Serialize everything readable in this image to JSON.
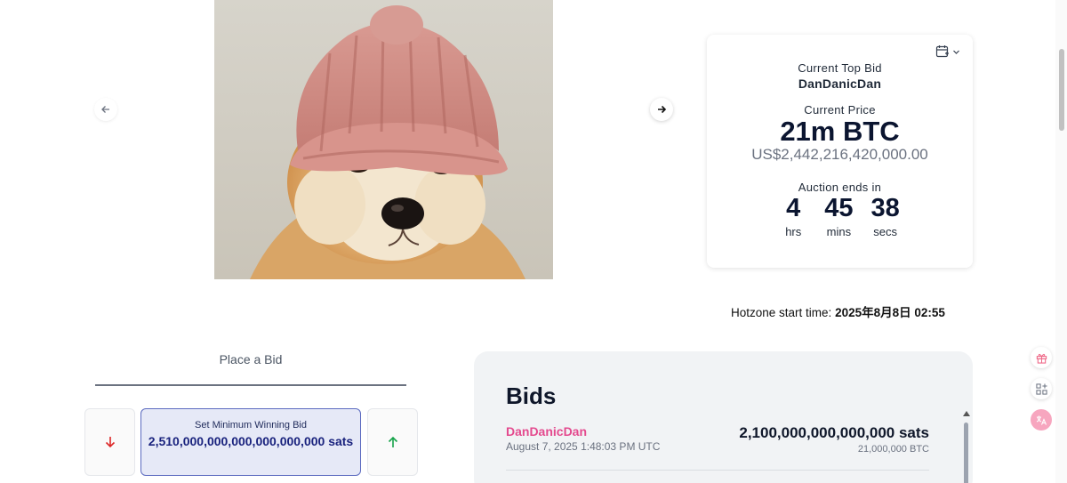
{
  "artwork": {
    "alt": "Shiba Inu dog wearing a pink knitted beanie"
  },
  "auction": {
    "top_bid_label": "Current Top Bid",
    "top_bidder": "DanDanicDan",
    "price_label": "Current Price",
    "price_btc": "21m BTC",
    "price_usd": "US$2,442,216,420,000.00",
    "ends_label": "Auction ends in",
    "countdown": [
      {
        "value": "4",
        "unit": "hrs"
      },
      {
        "value": "45",
        "unit": "mins"
      },
      {
        "value": "38",
        "unit": "secs"
      }
    ]
  },
  "hotzone": {
    "label": "Hotzone start time:",
    "value": "2025年8月8日 02:55"
  },
  "place_bid": {
    "title": "Place a Bid",
    "min_bid_label": "Set Minimum Winning Bid",
    "min_bid_value": "2,510,000,000,000,000,000,000 sats"
  },
  "bids": {
    "title": "Bids",
    "items": [
      {
        "bidder": "DanDanicDan",
        "time": "August 7, 2025 1:48:03 PM UTC",
        "sats": "2,100,000,000,000,000 sats",
        "btc": "21,000,000 BTC"
      }
    ]
  },
  "icons": {
    "prev": "arrow-left-icon",
    "next": "arrow-right-icon",
    "calendar": "calendar-add-icon",
    "decrease": "arrow-down-icon",
    "increase": "arrow-up-icon",
    "gift": "gift-icon",
    "apps": "apps-add-icon",
    "translate": "translate-icon"
  },
  "colors": {
    "accent_pink": "#e44a8e",
    "decrease_red": "#dc2626",
    "increase_green": "#16a34a",
    "min_bid_bg": "#e6e9f7",
    "min_bid_border": "#5c6bc0",
    "navy": "#0b1530"
  }
}
